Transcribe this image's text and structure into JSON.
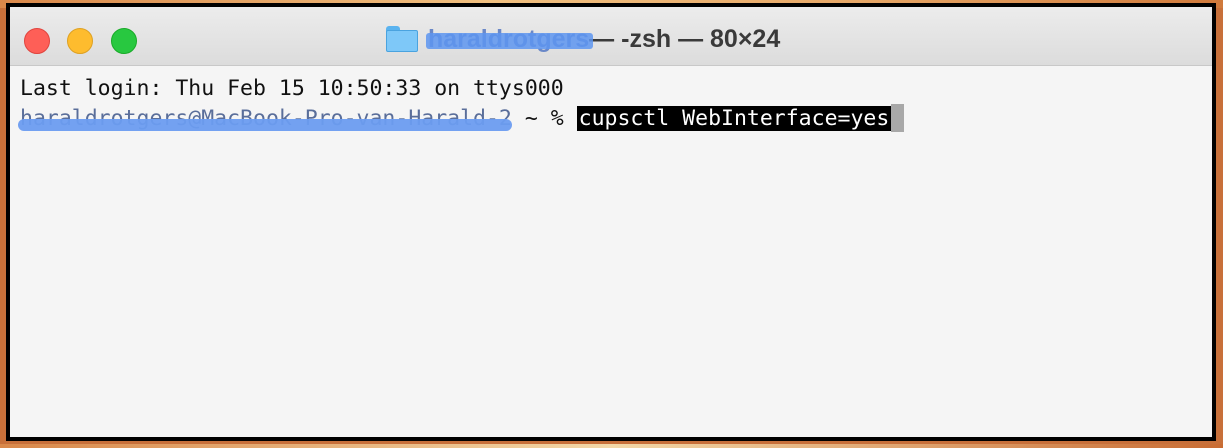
{
  "window": {
    "title_redacted_user": "haraldrotgers",
    "title_suffix": " — -zsh — 80×24"
  },
  "terminal": {
    "last_login": "Last login: Thu Feb 15 10:50:33 on ttys000",
    "prompt_user_redacted": "haraldrotgers@MacBook-Pro-van-Harald-2",
    "prompt_suffix": " ~ % ",
    "command": "cupsctl WebInterface=yes"
  },
  "colors": {
    "close": "#fe5f57",
    "minimize": "#febc2e",
    "zoom": "#28c840",
    "redaction": "#5d95f0"
  },
  "icons": [
    "folder-icon"
  ]
}
